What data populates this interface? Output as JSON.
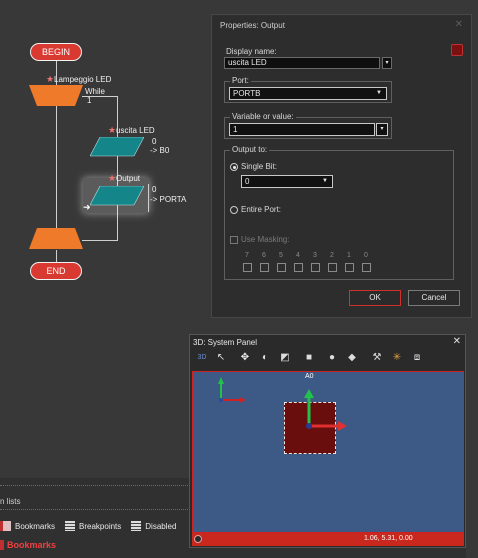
{
  "flowchart": {
    "begin": "BEGIN",
    "end": "END",
    "loop_title": "Lampeggio LED",
    "loop_kind": "While",
    "loop_cond": "1",
    "out1_name": "uscita LED",
    "out1_value": "0",
    "out1_target": "-> B0",
    "out2_name": "Output",
    "out2_value": "0",
    "out2_target": "-> PORTA"
  },
  "dialog": {
    "title": "Properties: Output",
    "display_name_label": "Display name:",
    "display_name_value": "uscita LED",
    "port_label": "Port:",
    "port_value": "PORTB",
    "var_label": "Variable or value:",
    "var_value": "1",
    "output_to_label": "Output to:",
    "single_bit_label": "Single Bit:",
    "single_bit_value": "0",
    "entire_port_label": "Entire Port:",
    "use_masking_label": "Use Masking:",
    "bits": [
      "7",
      "6",
      "5",
      "4",
      "3",
      "2",
      "1",
      "0"
    ],
    "ok": "OK",
    "cancel": "Cancel"
  },
  "panel3d": {
    "title": "3D: System Panel",
    "tab_3d": "3D",
    "axis_label": "A0",
    "coords": "1.06, 5.31, 0.00",
    "colors": {
      "viewport": "#3d5a86",
      "object": "#6a0d0d",
      "status": "#c8281e"
    }
  },
  "bottom": {
    "section_title": "n lists",
    "tabs": [
      "Bookmarks",
      "Breakpoints",
      "Disabled"
    ],
    "active_label": "Bookmarks"
  }
}
